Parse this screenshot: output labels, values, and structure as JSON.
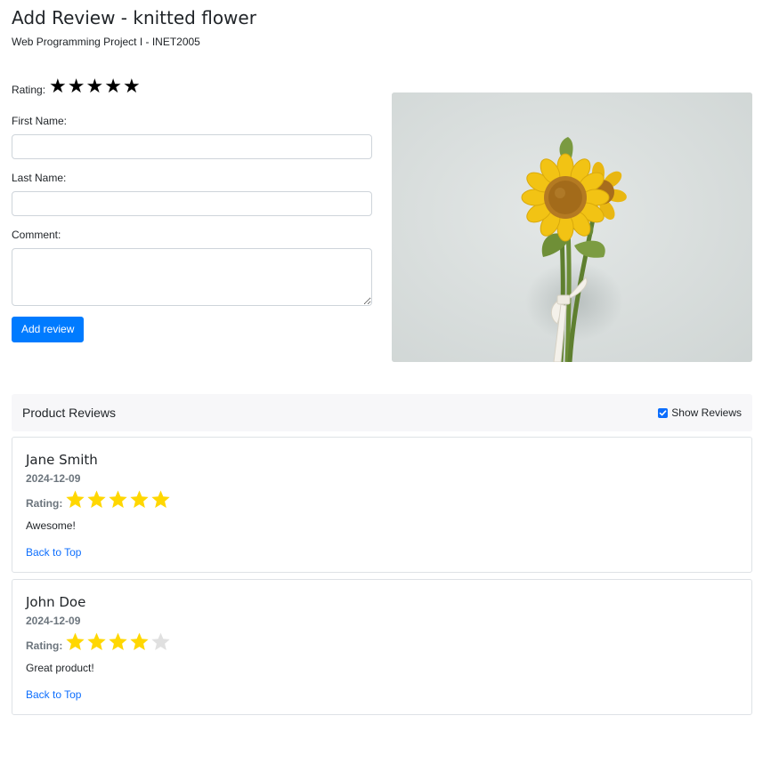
{
  "page": {
    "title": "Add Review - knitted flower",
    "subtitle": "Web Programming Project I - INET2005"
  },
  "form": {
    "rating_label": "Rating:",
    "rating_star_glyph": "★",
    "rating_stars_count": 5,
    "first_name_label": "First Name:",
    "first_name_value": "",
    "last_name_label": "Last Name:",
    "last_name_value": "",
    "comment_label": "Comment:",
    "comment_value": "",
    "submit_label": "Add review"
  },
  "product_image": {
    "icon": "knitted-sunflower-photo"
  },
  "reviews_section": {
    "title": "Product Reviews",
    "show_reviews_label": "Show Reviews",
    "show_reviews_checked": true
  },
  "reviews": [
    {
      "name": "Jane Smith",
      "date": "2024-12-09",
      "rating_label": "Rating:",
      "rating": 5,
      "max_rating": 5,
      "comment": "Awesome!",
      "back_to_top": "Back to Top"
    },
    {
      "name": "John Doe",
      "date": "2024-12-09",
      "rating_label": "Rating:",
      "rating": 4,
      "max_rating": 5,
      "comment": "Great product!",
      "back_to_top": "Back to Top"
    }
  ],
  "colors": {
    "accent": "#007bff",
    "link": "#0d6efd",
    "star_filled": "#ffd700",
    "star_empty": "#e0e0e0",
    "muted": "#6c757d"
  }
}
